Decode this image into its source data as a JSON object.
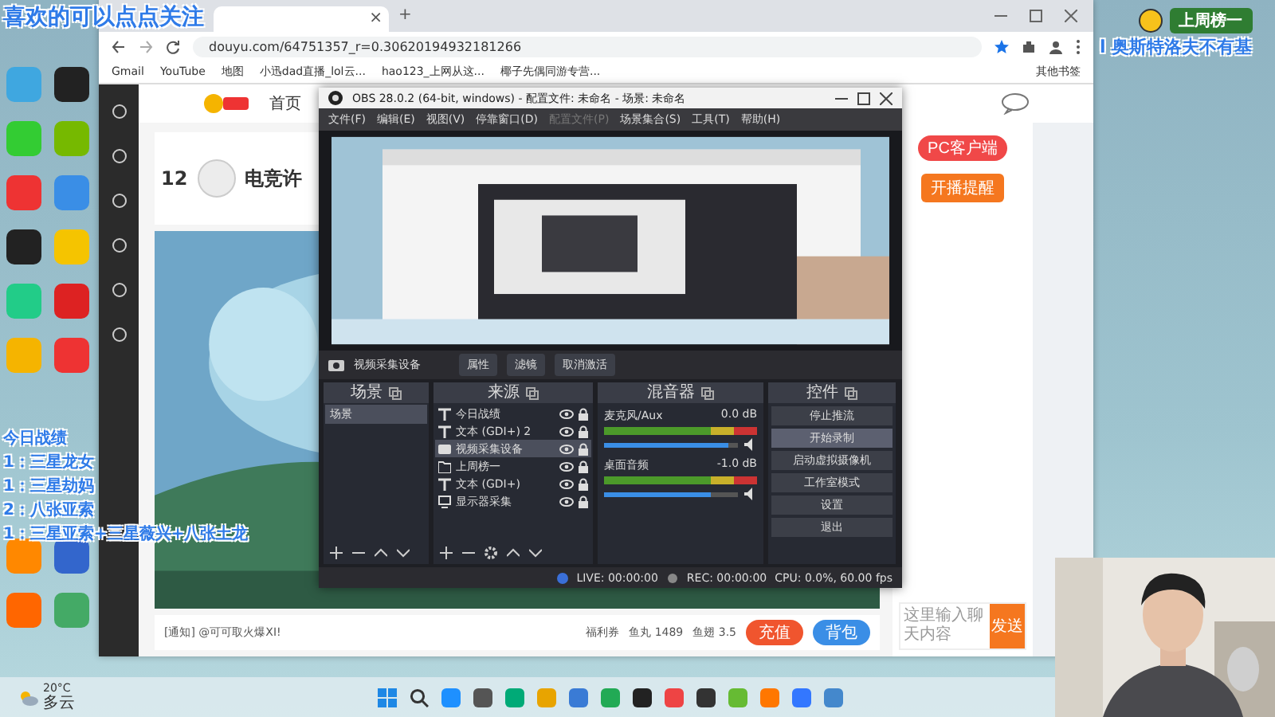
{
  "overlays": {
    "follow_text": "喜欢的可以点点关注",
    "weekly": {
      "title": "上周榜一",
      "name": "l 奥斯特洛夫不有基"
    },
    "record": {
      "title": "今日战绩",
      "lines": [
        "1：三星龙女",
        "1：三星劫妈",
        "2：八张亚索",
        "1：三星亚索+三星薇兴+八张土龙"
      ]
    }
  },
  "browser": {
    "tab_close": "×",
    "new_tab": "+",
    "address": "douyu.com/64751357_r=0.30620194932181266",
    "bookmarks": [
      "Gmail",
      "YouTube",
      "地图",
      "小迅dad直播_lol云...",
      "hao123_上网从这...",
      "椰子先偶同游专营..."
    ],
    "other_bookmarks": "其他书签"
  },
  "site": {
    "nav": [
      "首页"
    ],
    "level": "12",
    "streamer": "电竞许",
    "pc_client": "PC客户端",
    "remind": "开播提醒",
    "notice": "[通知] @可可取火爆XI!",
    "wallet": [
      "福利券",
      "鱼丸 1489",
      "鱼翅 3.5"
    ],
    "buttons": [
      {
        "label": "充值",
        "kind": "primary"
      },
      {
        "label": "背包",
        "kind": "secondary"
      }
    ],
    "chat_placeholder": "这里输入聊天内容",
    "send": "发送"
  },
  "obs": {
    "title": "OBS 28.0.2 (64-bit, windows) - 配置文件: 未命名 - 场景: 未命名",
    "menu": [
      {
        "label": "文件(F)",
        "disabled": false
      },
      {
        "label": "编辑(E)",
        "disabled": false
      },
      {
        "label": "视图(V)",
        "disabled": false
      },
      {
        "label": "停靠窗口(D)",
        "disabled": false
      },
      {
        "label": "配置文件(P)",
        "disabled": true
      },
      {
        "label": "场景集合(S)",
        "disabled": false
      },
      {
        "label": "工具(T)",
        "disabled": false
      },
      {
        "label": "帮助(H)",
        "disabled": false
      }
    ],
    "source_bar": {
      "name": "视频采集设备",
      "buttons": [
        "属性",
        "滤镜",
        "取消激活"
      ]
    },
    "docks": [
      "场景",
      "来源",
      "混音器",
      "控件"
    ],
    "scenes": [
      {
        "name": "场景",
        "selected": true
      }
    ],
    "sources": [
      {
        "name": "今日战绩",
        "kind": "text",
        "selected": false
      },
      {
        "name": "文本 (GDI+) 2",
        "kind": "text",
        "selected": false
      },
      {
        "name": "视频采集设备",
        "kind": "camera",
        "selected": true
      },
      {
        "name": "上周榜一",
        "kind": "group",
        "selected": false
      },
      {
        "name": "文本 (GDI+)",
        "kind": "text",
        "selected": false
      },
      {
        "name": "显示器采集",
        "kind": "display",
        "selected": false
      }
    ],
    "mixer": [
      {
        "name": "麦克风/Aux",
        "reading": "0.0 dB",
        "level": 0.93
      },
      {
        "name": "桌面音频",
        "reading": "-1.0 dB",
        "level": 0.8
      }
    ],
    "controls": [
      {
        "label": "停止推流",
        "highlighted": false
      },
      {
        "label": "开始录制",
        "highlighted": true
      },
      {
        "label": "启动虚拟摄像机",
        "highlighted": false
      },
      {
        "label": "工作室模式",
        "highlighted": false
      },
      {
        "label": "设置",
        "highlighted": false
      },
      {
        "label": "退出",
        "highlighted": false
      }
    ],
    "status": {
      "live": "LIVE: 00:00:00",
      "rec": "REC: 00:00:00",
      "cpu": "CPU: 0.0%, 60.00 fps"
    }
  },
  "taskbar": {
    "temperature": "20°C",
    "weather": "多云"
  }
}
